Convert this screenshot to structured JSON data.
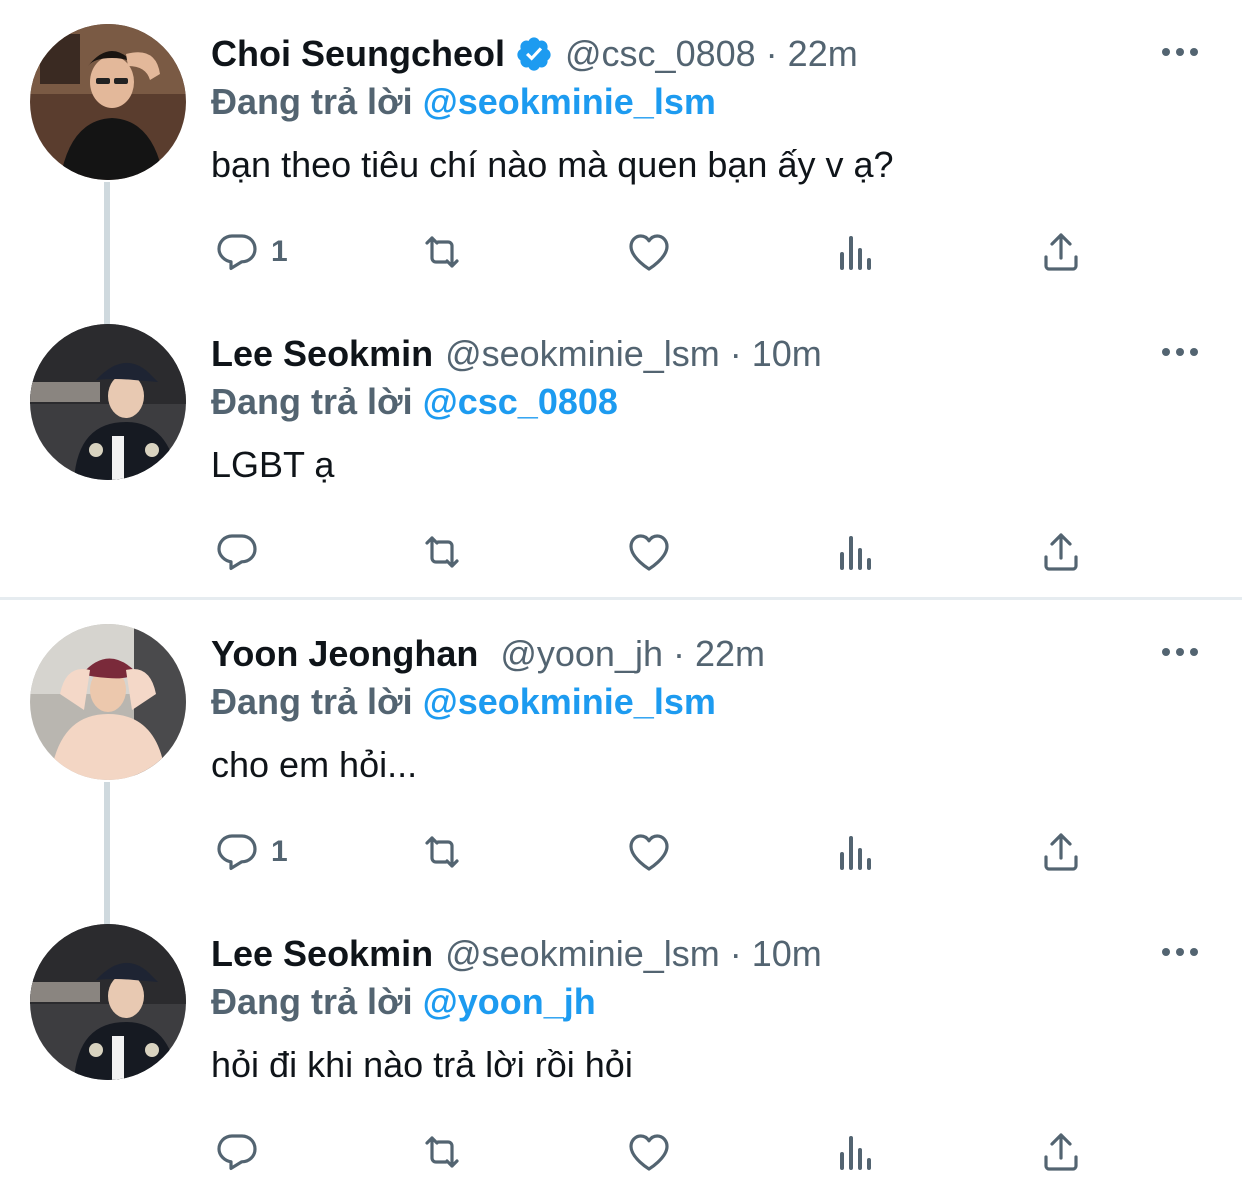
{
  "conversations": [
    {
      "tweets": [
        {
          "name": "Choi Seungcheol",
          "verified": true,
          "handle": "@csc_0808",
          "separator": "·",
          "time": "22m",
          "replying_label": "Đang trả lời",
          "replying_to": "@seokminie_lsm",
          "text": "bạn theo tiêu chí nào mà quen bạn ấy v ạ?",
          "reply_count": "1",
          "avatar": "avatar-dark-shirt"
        },
        {
          "name": "Lee Seokmin",
          "verified": false,
          "handle": "@seokminie_lsm",
          "separator": "·",
          "time": "10m",
          "replying_label": "Đang trả lời",
          "replying_to": "@csc_0808",
          "text": "LGBT ạ",
          "reply_count": "",
          "avatar": "avatar-cap-jacket"
        }
      ]
    },
    {
      "tweets": [
        {
          "name": "Yoon Jeonghan",
          "verified": false,
          "handle": "@yoon_jh",
          "separator": "·",
          "time": "22m",
          "replying_label": "Đang trả lời",
          "replying_to": "@seokminie_lsm",
          "text": "cho em hỏi...",
          "reply_count": "1",
          "avatar": "avatar-red-cap"
        },
        {
          "name": "Lee Seokmin",
          "verified": false,
          "handle": "@seokminie_lsm",
          "separator": "·",
          "time": "10m",
          "replying_label": "Đang trả lời",
          "replying_to": "@yoon_jh",
          "text": "hỏi đi khi nào trả lời rồi hỏi",
          "reply_count": "",
          "avatar": "avatar-cap-jacket"
        }
      ]
    }
  ],
  "icons": {
    "reply": "reply-icon",
    "retweet": "retweet-icon",
    "like": "like-icon",
    "views": "views-icon",
    "share": "share-icon",
    "more": "more-icon",
    "verified": "verified-badge-icon"
  },
  "colors": {
    "text": "#0f1419",
    "secondary": "#536471",
    "mention": "#1d9bf0",
    "thread_line": "#cfd9de"
  }
}
